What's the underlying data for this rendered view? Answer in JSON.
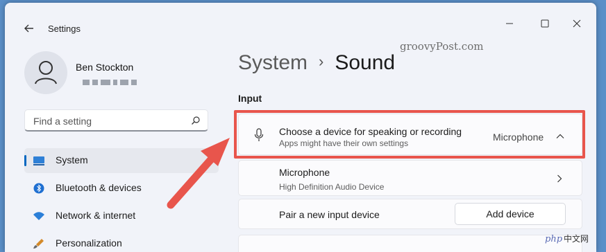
{
  "window": {
    "title": "Settings"
  },
  "user": {
    "name": "Ben Stockton"
  },
  "search": {
    "placeholder": "Find a setting"
  },
  "sidebar": {
    "items": [
      {
        "label": "System",
        "icon": "system-icon",
        "selected": true
      },
      {
        "label": "Bluetooth & devices",
        "icon": "bluetooth-icon"
      },
      {
        "label": "Network & internet",
        "icon": "wifi-icon"
      },
      {
        "label": "Personalization",
        "icon": "brush-icon"
      }
    ]
  },
  "breadcrumb": {
    "parent": "System",
    "separator": "›",
    "current": "Sound"
  },
  "input": {
    "heading": "Input",
    "choose_device": {
      "title": "Choose a device for speaking or recording",
      "subtitle": "Apps might have their own settings",
      "value": "Microphone"
    },
    "microphone": {
      "title": "Microphone",
      "subtitle": "High Definition Audio Device"
    },
    "pair_device": {
      "title": "Pair a new input device",
      "button": "Add device"
    }
  },
  "watermark": "groovyPost.com",
  "logo": {
    "php": "php",
    "cn": "中文网"
  },
  "colors": {
    "highlight": "#e8554c",
    "accent": "#0067c0",
    "background": "#5b8fc8"
  }
}
